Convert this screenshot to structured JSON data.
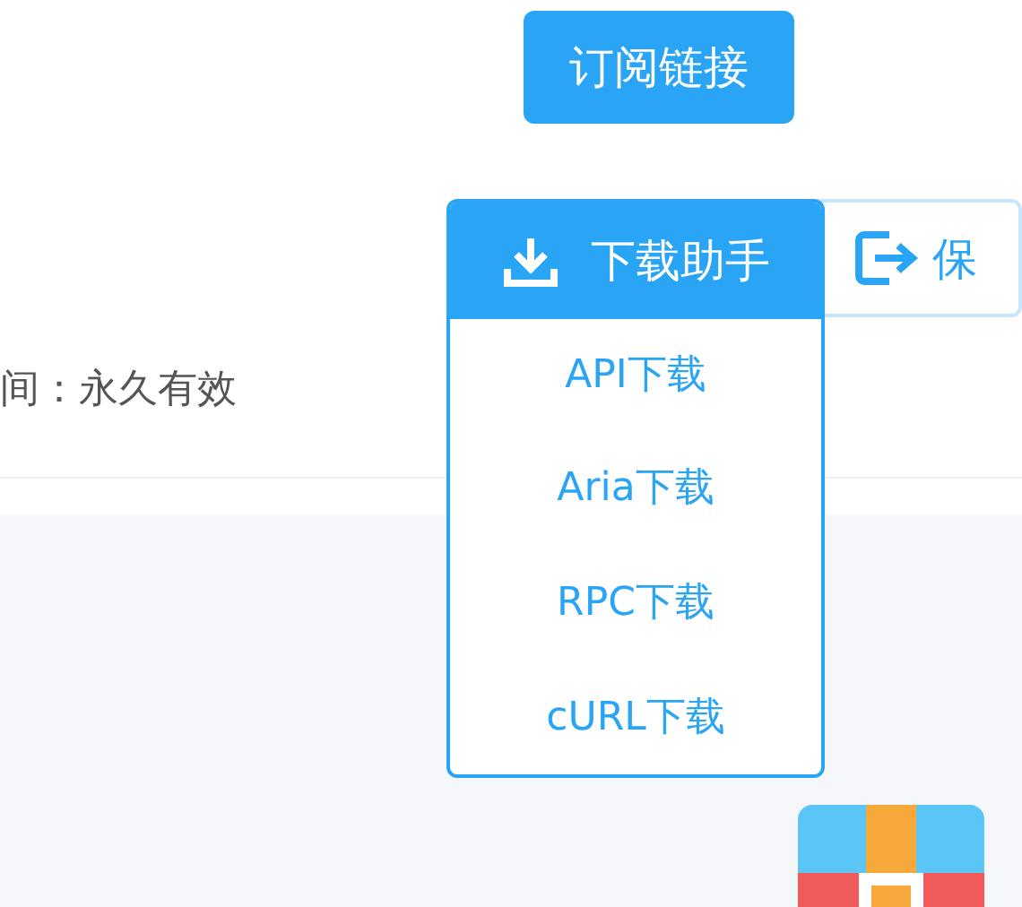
{
  "subscribe_button": {
    "label": "订阅链接"
  },
  "download_menu": {
    "label": "下载助手",
    "expanded": true,
    "items": [
      {
        "label": "API下载"
      },
      {
        "label": "Aria下载"
      },
      {
        "label": "RPC下载"
      },
      {
        "label": "cURL下载"
      }
    ]
  },
  "save_button": {
    "label": "保"
  },
  "validity_text": "间：永久有效"
}
